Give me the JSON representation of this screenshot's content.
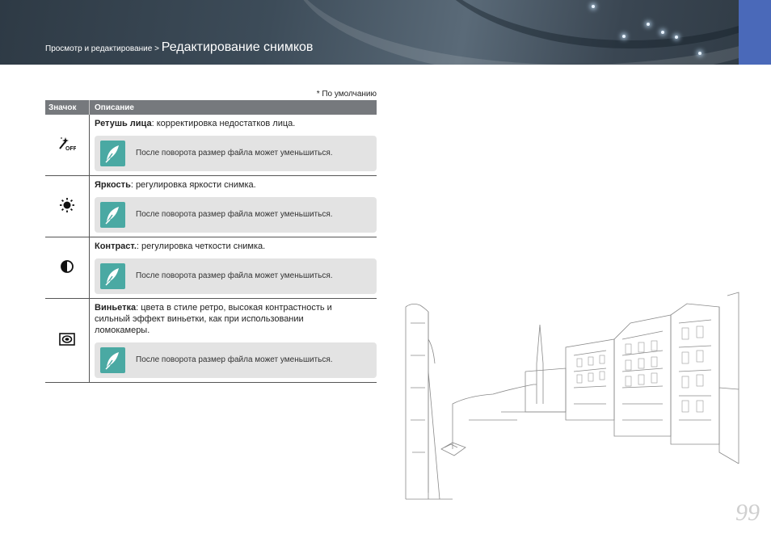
{
  "header": {
    "crumb": "Просмотр и редактирование > ",
    "title": "Редактирование снимков"
  },
  "default_note": "* По умолчанию",
  "table": {
    "headers": [
      "Значок",
      "Описание"
    ],
    "rows": [
      {
        "icon": "face-retouch-off-icon",
        "term": "Ретушь лица",
        "text": ": корректировка недостатков лица.",
        "note": "После поворота размер файла может уменьшиться."
      },
      {
        "icon": "brightness-icon",
        "term": "Яркость",
        "text": ": регулировка яркости снимка.",
        "note": "После поворота размер файла может уменьшиться."
      },
      {
        "icon": "contrast-icon",
        "term": "Контраст.",
        "text": ": регулировка четкости снимка.",
        "note": "После поворота размер файла может уменьшиться."
      },
      {
        "icon": "vignette-icon",
        "term": "Виньетка",
        "text": ": цвета в стиле ретро, высокая контрастность и сильный эффект виньетки, как при использовании ломокамеры.",
        "note": "После поворота размер файла может уменьшиться."
      }
    ]
  },
  "page_number": "99",
  "colors": {
    "accent_tab": "#4a69b9",
    "note_icon": "#4aa9a3",
    "header_row": "#76797d"
  }
}
